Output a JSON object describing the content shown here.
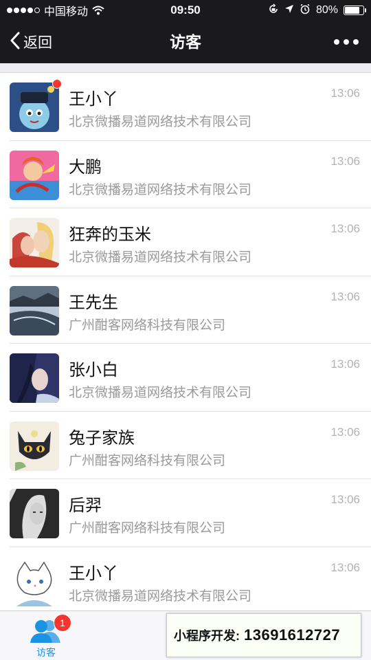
{
  "status_bar": {
    "carrier": "中国移动",
    "time": "09:50",
    "battery_percent": "80%",
    "battery_level": 0.8,
    "icons": [
      "signal-icon",
      "wifi-icon",
      "orientation-lock-icon",
      "location-icon",
      "alarm-icon",
      "battery-icon"
    ]
  },
  "nav": {
    "back_label": "返回",
    "title": "访客",
    "more_icon": "more-icon"
  },
  "visitors": [
    {
      "name": "王小丫",
      "company": "北京微播易道网络技术有限公司",
      "time": "13:06",
      "unread": true
    },
    {
      "name": "大鹏",
      "company": "北京微播易道网络技术有限公司",
      "time": "13:06",
      "unread": false
    },
    {
      "name": "狂奔的玉米",
      "company": "北京微播易道网络技术有限公司",
      "time": "13:06",
      "unread": false
    },
    {
      "name": "王先生",
      "company": "广州酣客网络科技有限公司",
      "time": "13:06",
      "unread": false
    },
    {
      "name": "张小白",
      "company": "北京微播易道网络技术有限公司",
      "time": "13:06",
      "unread": false
    },
    {
      "name": "兔子家族",
      "company": "广州酣客网络科技有限公司",
      "time": "13:06",
      "unread": false
    },
    {
      "name": "后羿",
      "company": "广州酣客网络科技有限公司",
      "time": "13:06",
      "unread": false
    },
    {
      "name": "王小丫",
      "company": "北京微播易道网络技术有限公司",
      "time": "13:06",
      "unread": false
    }
  ],
  "tabbar": {
    "visitors_label": "访客",
    "visitors_badge": "1",
    "accent": "#1a94e2"
  },
  "promo": {
    "label": "小程序开发:",
    "phone": "13691612727"
  },
  "colors": {
    "nav_bg": "#1a1a1c",
    "badge_red": "#f43530",
    "secondary_text": "#9a9a9a"
  }
}
